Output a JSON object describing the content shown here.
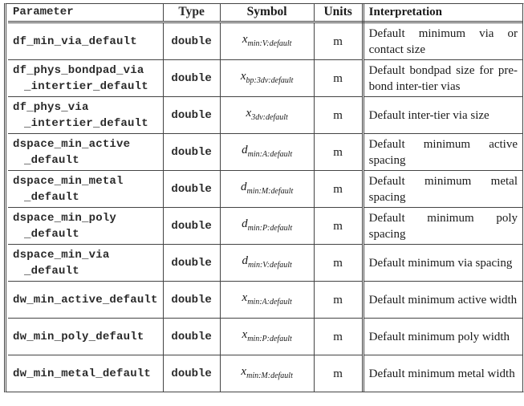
{
  "table": {
    "headers": {
      "parameter": "Parameter",
      "type": "Type",
      "symbol": "Symbol",
      "units": "Units",
      "interpretation": "Interpretation"
    },
    "rows": [
      {
        "parameter_lines": [
          "df_min_via_default"
        ],
        "type": "double",
        "symbol_base": "x",
        "symbol_sub": "min:V:default",
        "units": "m",
        "interpretation": "Default minimum via or contact size"
      },
      {
        "parameter_lines": [
          "df_phys_bondpad_via",
          "_intertier_default"
        ],
        "type": "double",
        "symbol_base": "x",
        "symbol_sub": "bp:3dv:default",
        "units": "m",
        "interpretation": "Default bondpad size for pre-bond inter-tier vias"
      },
      {
        "parameter_lines": [
          "df_phys_via",
          "_intertier_default"
        ],
        "type": "double",
        "symbol_base": "x",
        "symbol_sub": "3dv:default",
        "units": "m",
        "interpretation": "Default inter-tier via size"
      },
      {
        "parameter_lines": [
          "dspace_min_active",
          "_default"
        ],
        "type": "double",
        "symbol_base": "d",
        "symbol_sub": "min:A:default",
        "units": "m",
        "interpretation": "Default minimum active spacing"
      },
      {
        "parameter_lines": [
          "dspace_min_metal",
          "_default"
        ],
        "type": "double",
        "symbol_base": "d",
        "symbol_sub": "min:M:default",
        "units": "m",
        "interpretation": "Default minimum metal spacing"
      },
      {
        "parameter_lines": [
          "dspace_min_poly",
          "_default"
        ],
        "type": "double",
        "symbol_base": "d",
        "symbol_sub": "min:P:default",
        "units": "m",
        "interpretation": "Default minimum poly spacing"
      },
      {
        "parameter_lines": [
          "dspace_min_via",
          "_default"
        ],
        "type": "double",
        "symbol_base": "d",
        "symbol_sub": "min:V:default",
        "units": "m",
        "interpretation": "Default minimum via spacing"
      },
      {
        "parameter_lines": [
          "dw_min_active_default"
        ],
        "type": "double",
        "symbol_base": "x",
        "symbol_sub": "min:A:default",
        "units": "m",
        "interpretation": "Default minimum active width"
      },
      {
        "parameter_lines": [
          "dw_min_poly_default"
        ],
        "type": "double",
        "symbol_base": "x",
        "symbol_sub": "min:P:default",
        "units": "m",
        "interpretation": "Default minimum poly width"
      },
      {
        "parameter_lines": [
          "dw_min_metal_default"
        ],
        "type": "double",
        "symbol_base": "x",
        "symbol_sub": "min:M:default",
        "units": "m",
        "interpretation": "Default minimum metal width"
      }
    ]
  }
}
